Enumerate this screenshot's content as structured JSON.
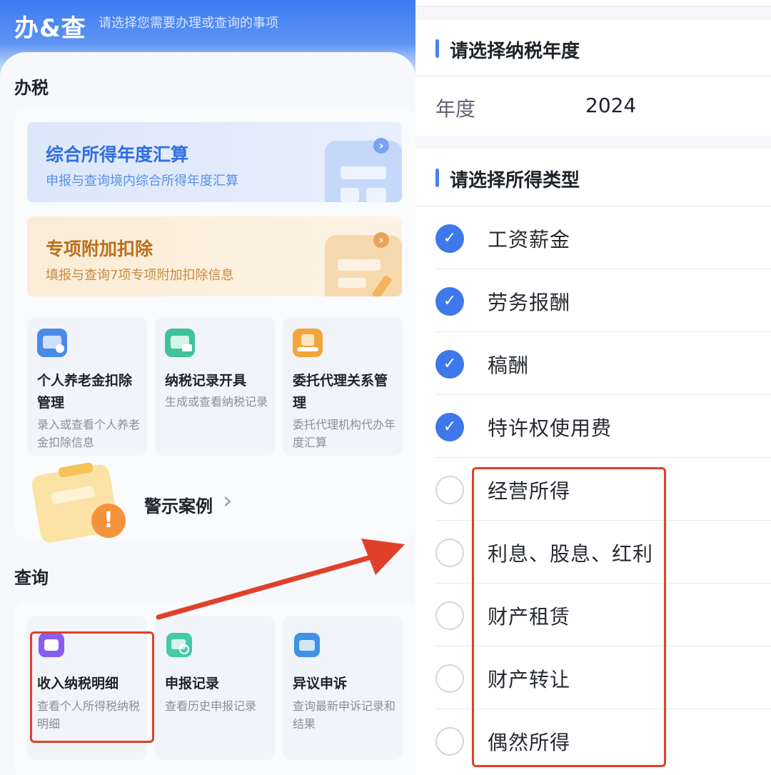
{
  "header": {
    "title": "办&查",
    "subtitle": "请选择您需要办理或查询的事项"
  },
  "sections": {
    "handle": "办税",
    "query": "查询"
  },
  "banners": [
    {
      "title": "综合所得年度汇算",
      "subtitle": "申报与查询境内综合所得年度汇算",
      "accent": "#2f6fe0"
    },
    {
      "title": "专项附加扣除",
      "subtitle": "填报与查询7项专项附加扣除信息",
      "accent": "#b8701a"
    }
  ],
  "handle_tiles": [
    {
      "title": "个人养老金扣除管理",
      "desc": "录入或查看个人养老金扣除信息",
      "icon": "pension-card-icon"
    },
    {
      "title": "纳税记录开具",
      "desc": "生成或查看纳税记录",
      "icon": "tax-record-icon"
    },
    {
      "title": "委托代理关系管理",
      "desc": "委托代理机构代办年度汇算",
      "icon": "agency-hand-icon"
    }
  ],
  "warning": {
    "label": "警示案例",
    "chevron": "›"
  },
  "query_tiles": [
    {
      "title": "收入纳税明细",
      "desc": "查看个人所得税纳税明细",
      "icon": "income-wallet-icon"
    },
    {
      "title": "申报记录",
      "desc": "查看历史申报记录",
      "icon": "search-record-icon"
    },
    {
      "title": "异议申诉",
      "desc": "查询最新申诉记录和结果",
      "icon": "appeal-folder-icon"
    }
  ],
  "year_section": {
    "header": "请选择纳税年度",
    "label": "年度",
    "value": "2024"
  },
  "type_section": {
    "header": "请选择所得类型",
    "options": [
      {
        "label": "工资薪金",
        "checked": true
      },
      {
        "label": "劳务报酬",
        "checked": true
      },
      {
        "label": "稿酬",
        "checked": true
      },
      {
        "label": "特许权使用费",
        "checked": true
      },
      {
        "label": "经营所得",
        "checked": false
      },
      {
        "label": "利息、股息、红利",
        "checked": false
      },
      {
        "label": "财产租赁",
        "checked": false
      },
      {
        "label": "财产转让",
        "checked": false
      },
      {
        "label": "偶然所得",
        "checked": false
      }
    ]
  },
  "colors": {
    "brand_blue": "#3d7bf2",
    "check_blue": "#3e78eb",
    "highlight_red": "#e0402a"
  }
}
